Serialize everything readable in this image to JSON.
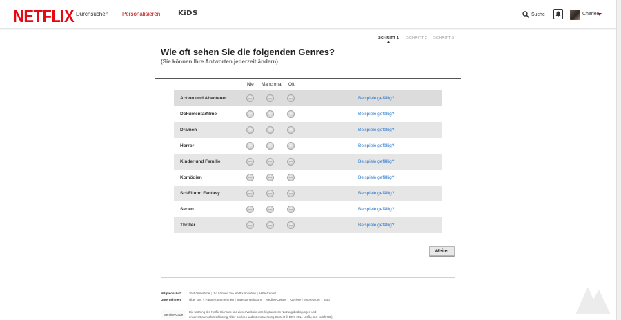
{
  "header": {
    "logo": "NETFLIX",
    "nav": [
      {
        "label": "Durchsuchen",
        "active": false
      },
      {
        "label": "Personalisieren",
        "active": true
      }
    ],
    "kids_label": "KiDS",
    "search_label": "Suche",
    "profile_name": "Charles"
  },
  "steps": [
    {
      "label": "SCHRITT 1",
      "active": true
    },
    {
      "label": "SCHRITT 2",
      "active": false
    },
    {
      "label": "SCHRITT 3",
      "active": false
    }
  ],
  "main": {
    "title": "Wie oft sehen Sie die folgenden Genres?",
    "subtitle": "(Sie können Ihre Antworten jederzeit ändern)",
    "columns": [
      "Nie",
      "Manchmal",
      "Oft"
    ],
    "example_link": "Beispiele gefällig?",
    "genres": [
      "Action und Abenteuer",
      "Dokumentarfilme",
      "Dramen",
      "Horror",
      "Kinder und Familie",
      "Komödien",
      "Sci-Fi und Fantasy",
      "Serien",
      "Thriller"
    ],
    "next_button": "Weiter"
  },
  "footer": {
    "membership_label": "Mitgliedschaft",
    "membership_links": [
      "Test-Teilnahme",
      "So können Sie Netflix ansehen",
      "Hilfe-Center"
    ],
    "company_label": "Unternehmen",
    "company_links": [
      "Über uns",
      "Partnerunternehmen",
      "Investor Relations",
      "Medien-Center",
      "Karriere",
      "Impressum",
      "Blog"
    ],
    "service_code": "Service-Code",
    "legal_line1": "Die Nutzung des Netflix-Dienstes und dieser Website unterliegt unseren Nutzungsbedingungen und",
    "legal_line2": "unserer Datenschutzerklärung. Über Cookies und Internetwerbung Content © 1997-2014 Netflix, Inc. {cd8f6785}"
  },
  "colors": {
    "brand_red": "#e50914",
    "link_blue": "#2a77c9"
  }
}
